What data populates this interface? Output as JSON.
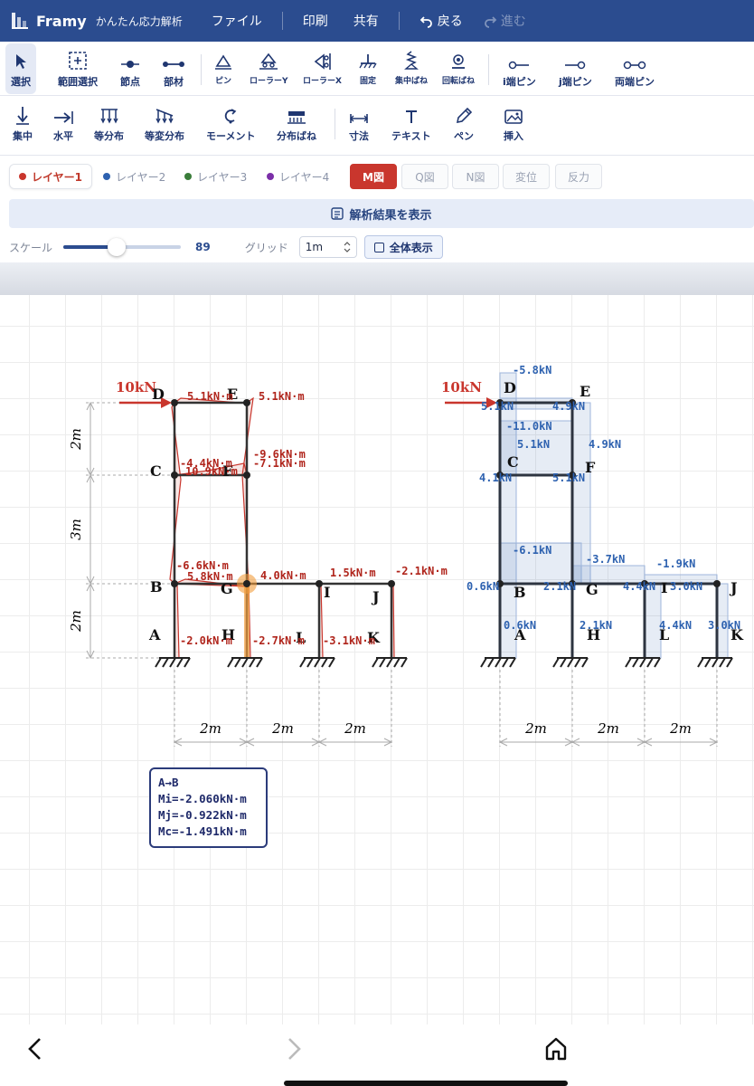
{
  "header": {
    "app_name": "Framy",
    "app_subtitle": "かんたん応力解析",
    "menu_file": "ファイル",
    "menu_print": "印刷",
    "menu_share": "共有",
    "back_label": "戻る",
    "forward_label": "進む"
  },
  "toolbar1": [
    {
      "name": "select",
      "label": "選択",
      "icon": "cursor-icon"
    },
    {
      "name": "range-select",
      "label": "範囲選択",
      "icon": "range-select-icon"
    },
    {
      "name": "node",
      "label": "節点",
      "icon": "node-icon"
    },
    {
      "name": "member",
      "label": "部材",
      "icon": "member-icon"
    },
    {
      "name": "pin",
      "label": "ピン",
      "icon": "pin-support-icon"
    },
    {
      "name": "roller-y",
      "label": "ローラーY",
      "icon": "roller-y-icon"
    },
    {
      "name": "roller-x",
      "label": "ローラーX",
      "icon": "roller-x-icon"
    },
    {
      "name": "fixed",
      "label": "固定",
      "icon": "fixed-support-icon"
    },
    {
      "name": "concentrated-spring",
      "label": "集中ばね",
      "icon": "spring-icon"
    },
    {
      "name": "rotational-spring",
      "label": "回転ばね",
      "icon": "rotational-spring-icon"
    },
    {
      "name": "i-pin",
      "label": "i端ピン",
      "icon": "i-end-pin-icon"
    },
    {
      "name": "j-pin",
      "label": "j端ピン",
      "icon": "j-end-pin-icon"
    },
    {
      "name": "both-pin",
      "label": "両端ピン",
      "icon": "both-end-pin-icon"
    }
  ],
  "toolbar2": [
    {
      "name": "concentrated",
      "label": "集中",
      "icon": "down-arrow-icon"
    },
    {
      "name": "horizontal",
      "label": "水平",
      "icon": "right-arrow-icon"
    },
    {
      "name": "uniform",
      "label": "等分布",
      "icon": "uniform-load-icon"
    },
    {
      "name": "varying",
      "label": "等変分布",
      "icon": "varying-load-icon"
    },
    {
      "name": "moment",
      "label": "モーメント",
      "icon": "moment-icon"
    },
    {
      "name": "distributed-spring",
      "label": "分布ばね",
      "icon": "distributed-spring-icon"
    },
    {
      "name": "dimension",
      "label": "寸法",
      "icon": "dimension-icon"
    },
    {
      "name": "text",
      "label": "テキスト",
      "icon": "text-icon"
    },
    {
      "name": "pen",
      "label": "ペン",
      "icon": "pen-icon"
    },
    {
      "name": "insert",
      "label": "挿入",
      "icon": "image-icon"
    }
  ],
  "layers": [
    {
      "label": "レイヤー1",
      "color": "#c9362d"
    },
    {
      "label": "レイヤー2",
      "color": "#2e62b0"
    },
    {
      "label": "レイヤー3",
      "color": "#3a7d3a"
    },
    {
      "label": "レイヤー4",
      "color": "#7b2fa8"
    }
  ],
  "result_buttons": [
    "M図",
    "Q図",
    "N図",
    "変位",
    "反力"
  ],
  "show_results_label": "解析結果を表示",
  "scale": {
    "label": "スケール",
    "value": "89",
    "fraction": 0.45
  },
  "grid": {
    "label": "グリッド",
    "value": "1m"
  },
  "fit_label": "全体表示",
  "structure": {
    "nodes": [
      {
        "id": "D",
        "frame": "left"
      },
      {
        "id": "E",
        "frame": "left"
      },
      {
        "id": "C",
        "frame": "left"
      },
      {
        "id": "F",
        "frame": "left"
      },
      {
        "id": "B",
        "frame": "left"
      },
      {
        "id": "G",
        "frame": "left"
      },
      {
        "id": "I",
        "frame": "left"
      },
      {
        "id": "J",
        "frame": "left"
      },
      {
        "id": "A",
        "frame": "left"
      },
      {
        "id": "H",
        "frame": "left"
      },
      {
        "id": "L",
        "frame": "left"
      },
      {
        "id": "K",
        "frame": "left"
      }
    ],
    "load_label": "10kN",
    "dims_vertical": [
      "2m",
      "3m",
      "2m"
    ],
    "dims_horizontal": [
      "2m",
      "2m",
      "2m"
    ]
  },
  "moment_labels": [
    "5.1kN·m",
    "5.1kN·m",
    "-4.4kN·m",
    "10.9kN·m",
    "-9.6kN·m",
    "-7.1kN·m",
    "-6.6kN·m",
    "5.8kN·m",
    "4.0kN·m",
    "1.5kN·m",
    "-2.1kN·m",
    "-2.0kN·m",
    "-2.7kN·m",
    "-3.1kN·m"
  ],
  "shear_labels": [
    "-5.8kN",
    "5.1kN",
    "4.9kN",
    "-11.0kN",
    "5.1kN",
    "4.9kN",
    "4.1kN",
    "5.1kN",
    "-6.1kN",
    "-3.7kN",
    "-1.9kN",
    "0.6kN",
    "2.1kN",
    "4.4kN",
    "3.0kN",
    "0.6kN",
    "2.1kN",
    "4.4kN",
    "3.0kN"
  ],
  "info": {
    "title": "A→B",
    "mi": "Mi=-2.060kN·m",
    "mj": "Mj=-0.922kN·m",
    "mc": "Mc=-1.491kN·m"
  }
}
